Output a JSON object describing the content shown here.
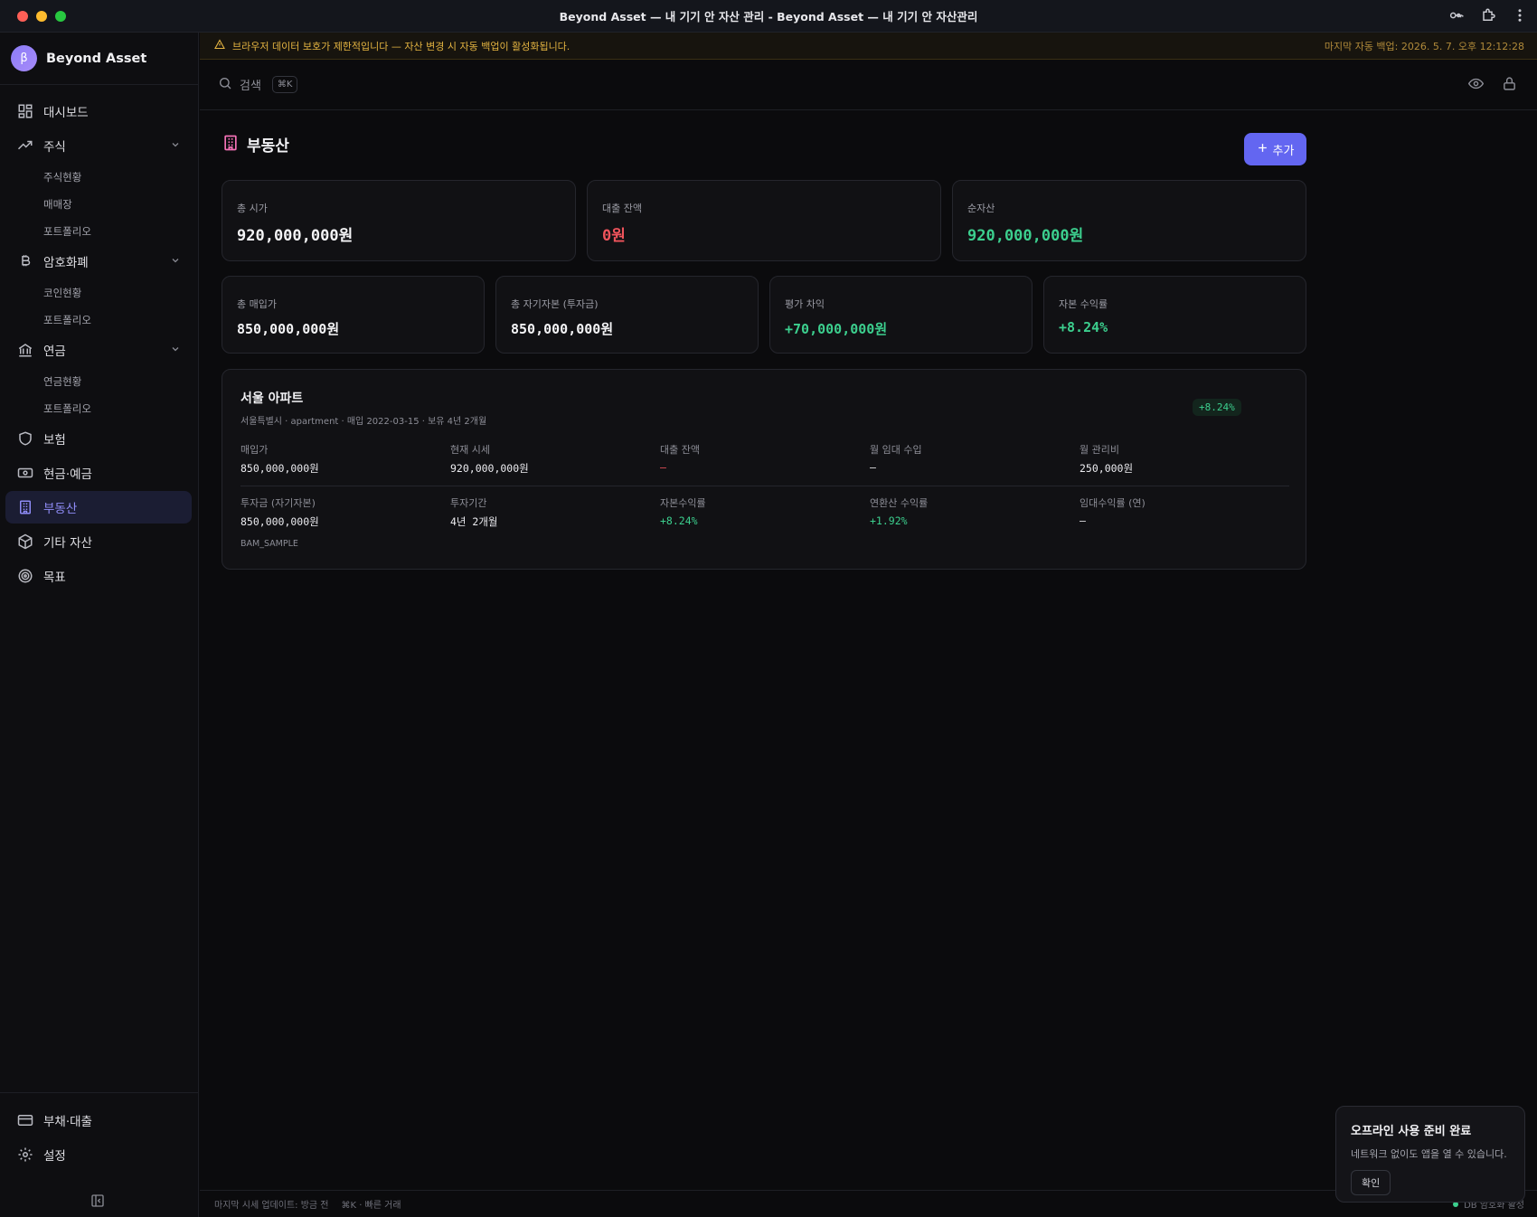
{
  "window": {
    "title": "Beyond Asset — 내 기기 안 자산 관리 - Beyond Asset — 내 기기 안 자산관리"
  },
  "colors": {
    "accent": "#6366f1",
    "positive": "#3ccf8e",
    "negative": "#f0545c",
    "warning": "#e3b341"
  },
  "brand": {
    "logo": "β",
    "name": "Beyond Asset"
  },
  "sidebar": {
    "items": [
      {
        "label": "대시보드",
        "icon": "dashboard-icon"
      },
      {
        "label": "주식",
        "icon": "trend-icon",
        "subitems": [
          "주식현황",
          "매매장",
          "포트폴리오"
        ]
      },
      {
        "label": "암호화폐",
        "icon": "bitcoin-icon",
        "subitems": [
          "코인현황",
          "포트폴리오"
        ]
      },
      {
        "label": "연금",
        "icon": "bank-icon",
        "subitems": [
          "연금현황",
          "포트폴리오"
        ]
      },
      {
        "label": "보험",
        "icon": "shield-icon"
      },
      {
        "label": "현금·예금",
        "icon": "cash-icon"
      },
      {
        "label": "부동산",
        "icon": "building-icon",
        "active": true
      },
      {
        "label": "기타 자산",
        "icon": "package-icon"
      },
      {
        "label": "목표",
        "icon": "target-icon"
      }
    ],
    "bottom": [
      {
        "label": "부채·대출",
        "icon": "card-icon"
      },
      {
        "label": "설정",
        "icon": "gear-icon"
      }
    ]
  },
  "warning": {
    "message": "브라우저 데이터 보호가 제한적입니다 — 자산 변경 시 자동 백업이 활성화됩니다.",
    "last_backup": "마지막 자동 백업: 2026. 5. 7. 오후 12:12:28"
  },
  "search": {
    "label": "검색",
    "shortcut": "⌘K"
  },
  "page": {
    "title": "부동산",
    "add_label": "추가"
  },
  "summary_top": [
    {
      "label": "총 시가",
      "value": "920,000,000원",
      "tone": "neutral"
    },
    {
      "label": "대출 잔액",
      "value": "0원",
      "tone": "negative"
    },
    {
      "label": "순자산",
      "value": "920,000,000원",
      "tone": "positive"
    }
  ],
  "summary_bottom": [
    {
      "label": "총 매입가",
      "value": "850,000,000원",
      "tone": "neutral"
    },
    {
      "label": "총 자기자본 (투자금)",
      "value": "850,000,000원",
      "tone": "neutral"
    },
    {
      "label": "평가 차익",
      "value": "+70,000,000원",
      "tone": "positive"
    },
    {
      "label": "자본 수익률",
      "value": "+8.24%",
      "tone": "positive"
    }
  ],
  "property": {
    "name": "서울 아파트",
    "meta": "서울특별시 · apartment · 매입 2022-03-15 · 보유 4년 2개월",
    "badge": "+8.24%",
    "row1": [
      {
        "label": "매입가",
        "value": "850,000,000원"
      },
      {
        "label": "현재 시세",
        "value": "920,000,000원"
      },
      {
        "label": "대출 잔액",
        "value": "—",
        "tone": "negative"
      },
      {
        "label": "월 임대 수입",
        "value": "—"
      },
      {
        "label": "월 관리비",
        "value": "250,000원"
      }
    ],
    "row2": [
      {
        "label": "투자금 (자기자본)",
        "value": "850,000,000원"
      },
      {
        "label": "투자기간",
        "value": "4년 2개월"
      },
      {
        "label": "자본수익률",
        "value": "+8.24%",
        "tone": "positive"
      },
      {
        "label": "연환산 수익률",
        "value": "+1.92%",
        "tone": "positive"
      },
      {
        "label": "임대수익률 (연)",
        "value": "—"
      }
    ],
    "tag": "BAM_SAMPLE"
  },
  "status_bar": {
    "update": "마지막 시세 업데이트: 방금 전",
    "hint": "⌘K · 빠른 거래",
    "db": "DB 암호화 활성"
  },
  "toast": {
    "title": "오프라인 사용 준비 완료",
    "body": "네트워크 없이도 앱을 열 수 있습니다.",
    "confirm": "확인"
  }
}
